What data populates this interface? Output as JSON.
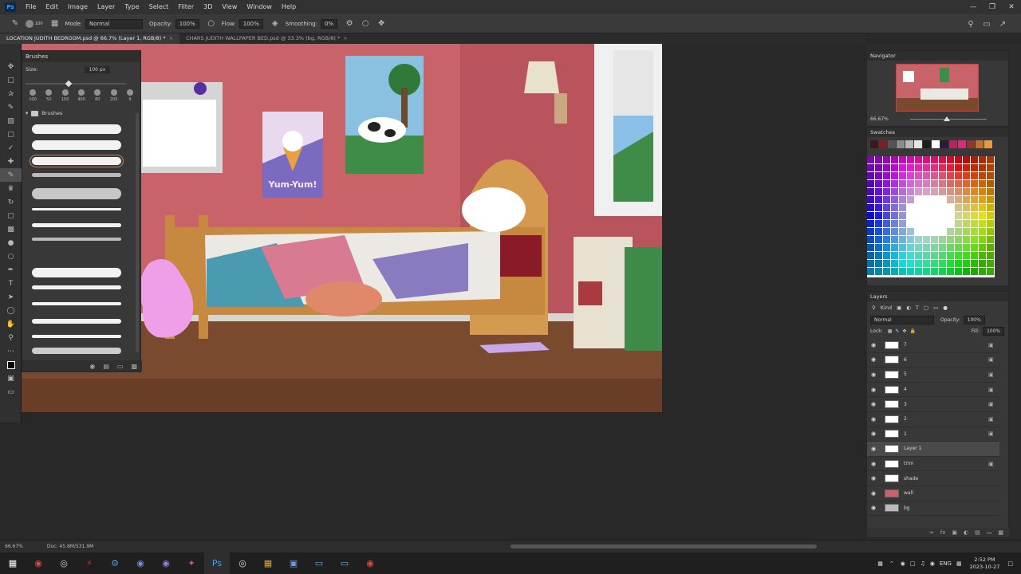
{
  "menu": {
    "app_icon": "Ps",
    "items": [
      "File",
      "Edit",
      "Image",
      "Layer",
      "Type",
      "Select",
      "Filter",
      "3D",
      "View",
      "Window",
      "Help"
    ]
  },
  "options": {
    "mode_label": "Mode:",
    "mode_value": "Normal",
    "opacity_label": "Opacity:",
    "opacity_value": "100%",
    "flow_label": "Flow:",
    "flow_value": "100%",
    "smoothing_label": "Smoothing:",
    "smoothing_value": "0%",
    "brush_size_value": "100"
  },
  "tabs": [
    {
      "label": "LOCATION JUDITH BEDROOM.psd @ 66.7% (Layer 1, RGB/8) *",
      "active": true
    },
    {
      "label": "CHARS JUDITH WALLPAPER BED.psd @ 33.3% (bg, RGB/8) *",
      "active": false
    }
  ],
  "brushes": {
    "title": "Brushes",
    "size_label": "Size:",
    "size_value": "100 px",
    "presets": [
      "100",
      "50",
      "150",
      "400",
      "80",
      "200",
      "9"
    ],
    "folder_label": "Brushes"
  },
  "artwork": {
    "poster_text": "Yum-Yum!"
  },
  "navigator": {
    "title": "Navigator",
    "zoom": "66.67%"
  },
  "swatches": {
    "title": "Swatches",
    "colors": [
      "#3a1a1a",
      "#7a1f2a",
      "#555555",
      "#8c8c8c",
      "#b8b8b8",
      "#e5e5e5",
      "#1e1e1e",
      "#ffffff",
      "#2b1a3a",
      "#b0285a",
      "#d0307a",
      "#8a3a2a",
      "#c07030",
      "#e0a040"
    ]
  },
  "layers": {
    "title": "Layers",
    "filter_label": "Kind",
    "blend_value": "Normal",
    "opacity_label": "Opacity:",
    "opacity_value": "100%",
    "lock_label": "Lock:",
    "fill_label": "Fill:",
    "fill_value": "100%",
    "items": [
      {
        "name": "7",
        "locked": true
      },
      {
        "name": "6",
        "locked": true
      },
      {
        "name": "5",
        "locked": true
      },
      {
        "name": "4",
        "locked": true
      },
      {
        "name": "3",
        "locked": true
      },
      {
        "name": "2",
        "locked": true
      },
      {
        "name": "1",
        "locked": true
      },
      {
        "name": "Layer 1",
        "locked": false,
        "active": true
      },
      {
        "name": "trim",
        "locked": true
      },
      {
        "name": "shade",
        "locked": false
      },
      {
        "name": "wall",
        "locked": false
      },
      {
        "name": "bg",
        "locked": false
      }
    ]
  },
  "status": {
    "zoom": "66.67%",
    "doc": "Doc: 45.8M/531.9M"
  },
  "taskbar": {
    "lang": "ENG",
    "time": "2:52 PM",
    "date": "2023-10-27"
  }
}
